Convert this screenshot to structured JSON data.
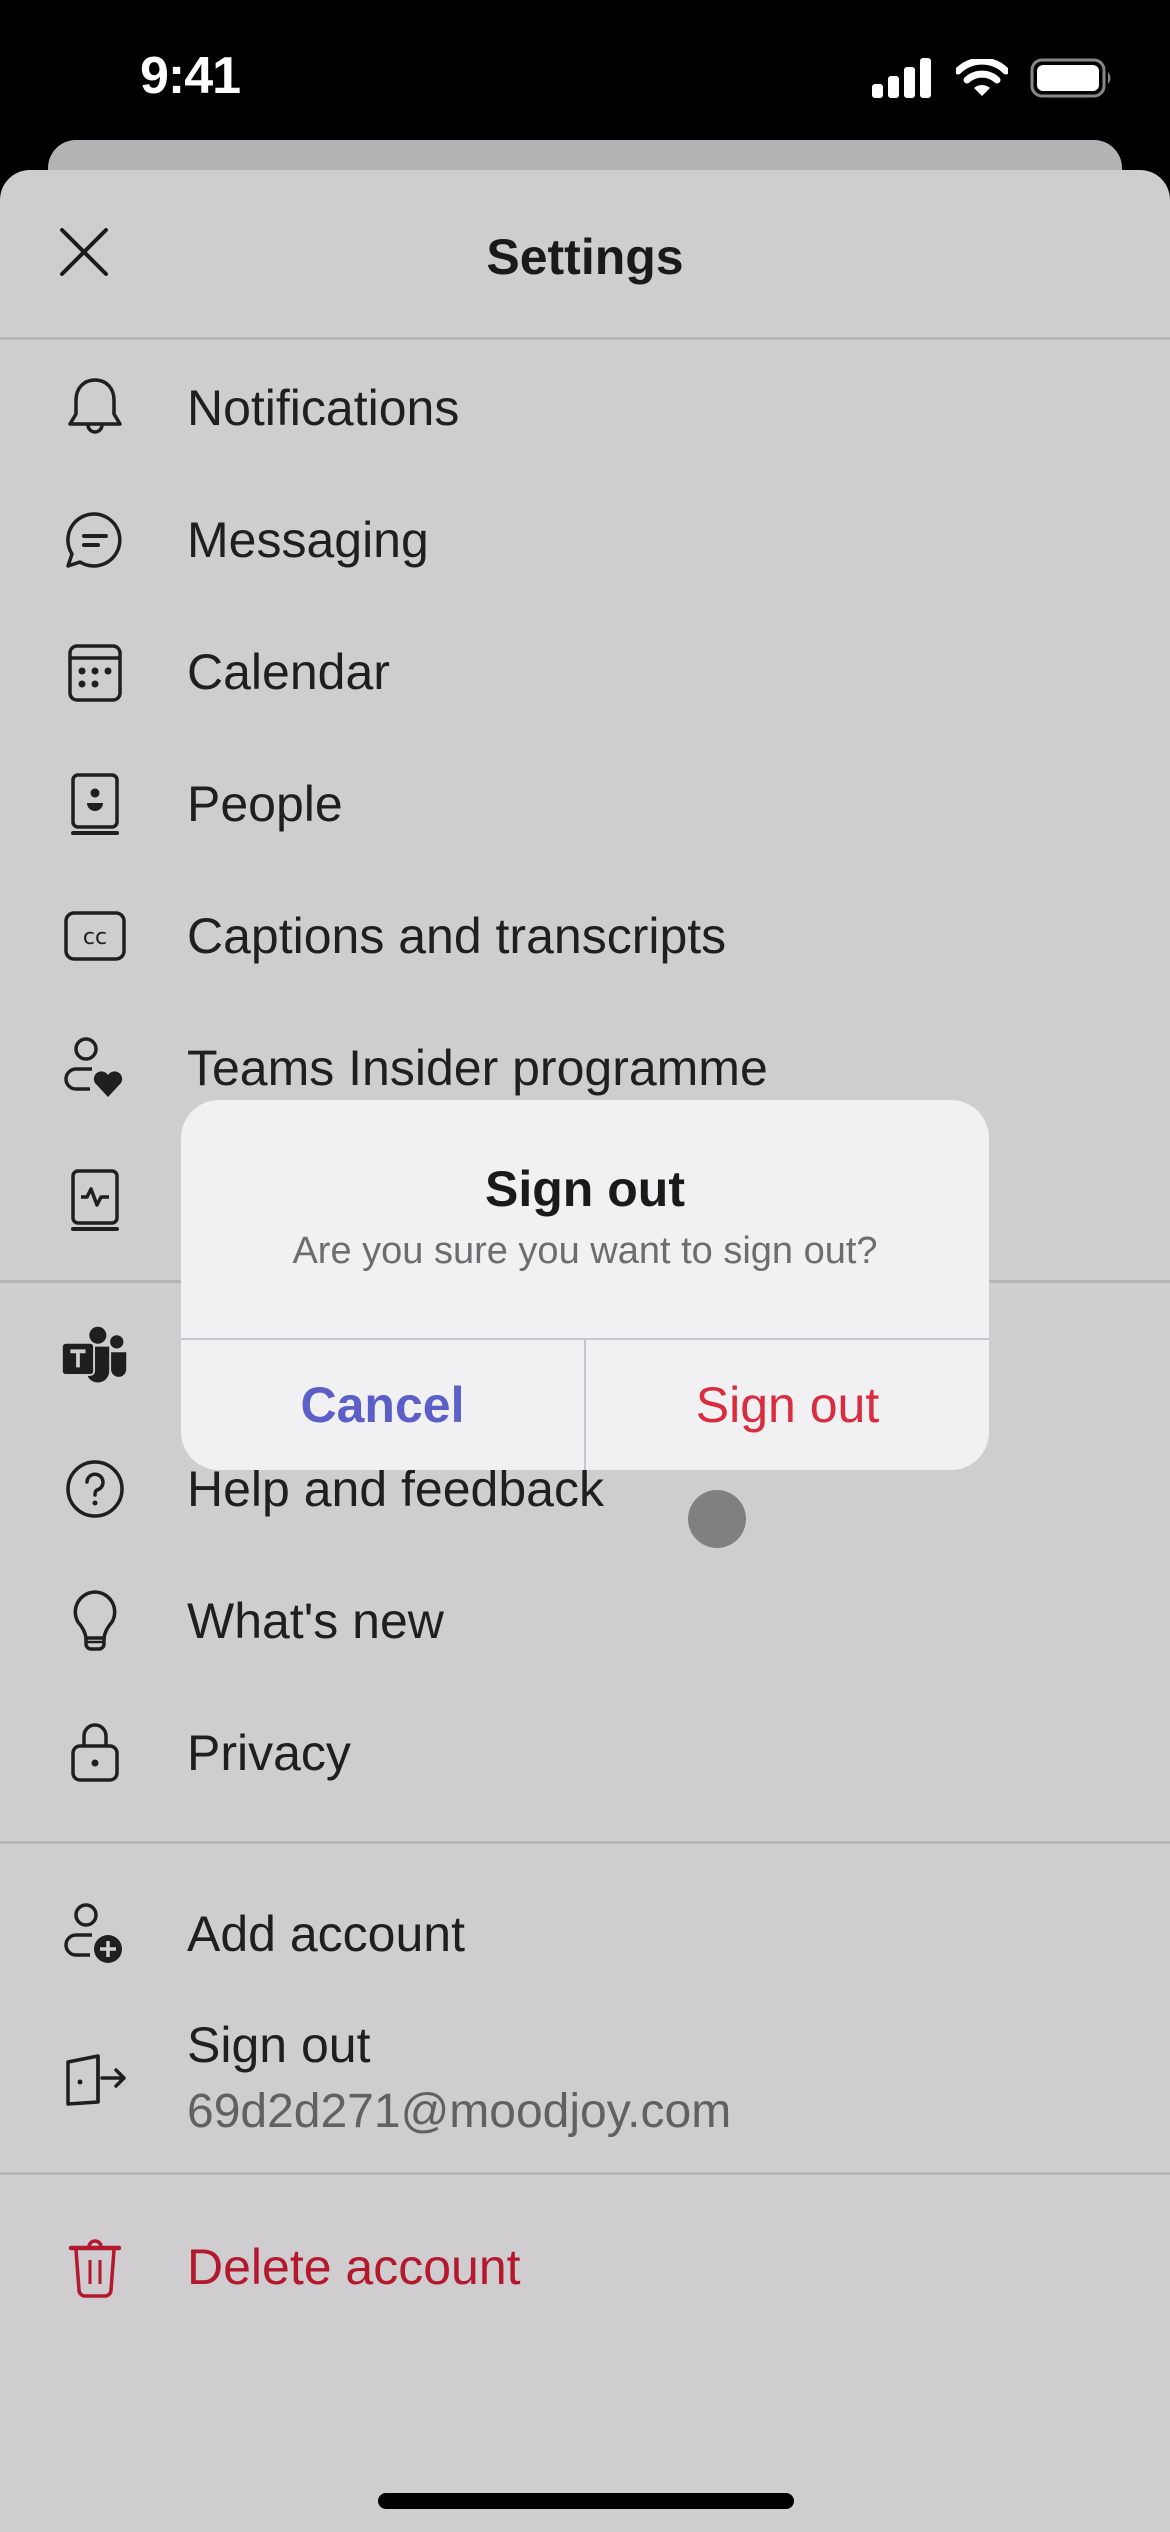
{
  "status_bar": {
    "time": "9:41",
    "icons": [
      "cellular-signal-icon",
      "wifi-icon",
      "battery-icon"
    ]
  },
  "header": {
    "title": "Settings",
    "close_icon": "close-icon"
  },
  "sections": [
    {
      "items": [
        {
          "icon": "bell-icon",
          "label": "Notifications"
        },
        {
          "icon": "chat-bubble-icon",
          "label": "Messaging"
        },
        {
          "icon": "calendar-icon",
          "label": "Calendar"
        },
        {
          "icon": "contact-book-icon",
          "label": "People"
        },
        {
          "icon": "closed-captions-icon",
          "label": "Captions and transcripts"
        },
        {
          "icon": "person-heart-icon",
          "label": "Teams Insider programme"
        },
        {
          "icon": "diagnostics-book-icon",
          "label": ""
        }
      ]
    },
    {
      "items": [
        {
          "icon": "teams-logo-icon",
          "label": ""
        },
        {
          "icon": "help-circle-icon",
          "label": "Help and feedback"
        },
        {
          "icon": "lightbulb-icon",
          "label": "What's new"
        },
        {
          "icon": "lock-icon",
          "label": "Privacy"
        }
      ]
    },
    {
      "items": [
        {
          "icon": "person-add-icon",
          "label": "Add account"
        },
        {
          "icon": "sign-out-door-icon",
          "label": "Sign out",
          "sublabel": "69d2d271@moodjoy.com"
        }
      ]
    },
    {
      "items": [
        {
          "icon": "trash-icon",
          "label": "Delete account"
        }
      ]
    }
  ],
  "dialog": {
    "title": "Sign out",
    "message": "Are you sure you want to sign out?",
    "cancel_label": "Cancel",
    "confirm_label": "Sign out"
  },
  "colors": {
    "accent": "#5b5fc7",
    "destructive": "#d92c3f",
    "danger_text": "#b4182c",
    "sheet_background": "#cfcdd0",
    "dialog_background": "#f1f0f3"
  }
}
